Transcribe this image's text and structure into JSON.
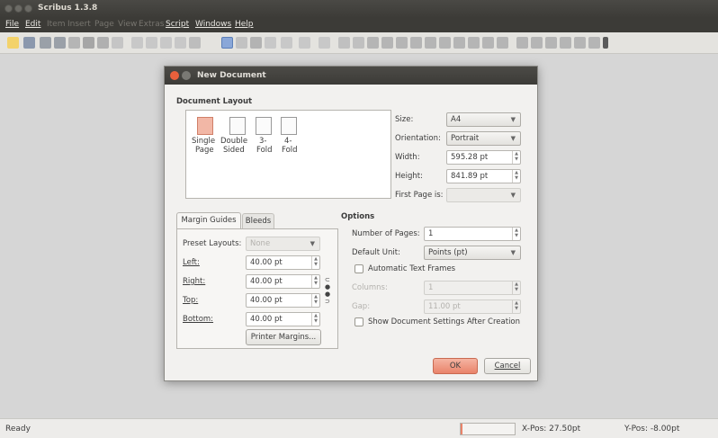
{
  "window": {
    "title": "Scribus 1.3.8"
  },
  "menu": [
    "File",
    "Edit",
    "Item",
    "Insert",
    "Page",
    "View",
    "Extras",
    "Script",
    "Windows",
    "Help"
  ],
  "menu_disabled": [
    false,
    false,
    true,
    true,
    true,
    true,
    true,
    false,
    false,
    false
  ],
  "dialog": {
    "title": "New Document",
    "layout_heading": "Document Layout",
    "layouts": [
      {
        "l1": "Single",
        "l2": "Page"
      },
      {
        "l1": "Double",
        "l2": "Sided"
      },
      {
        "l1": "3-",
        "l2": "Fold"
      },
      {
        "l1": "4-",
        "l2": "Fold"
      }
    ],
    "size_label": "Size:",
    "size_value": "A4",
    "orientation_label": "Orientation:",
    "orientation_value": "Portrait",
    "width_label": "Width:",
    "width_value": "595.28 pt",
    "height_label": "Height:",
    "height_value": "841.89 pt",
    "first_page_label": "First Page is:",
    "tabs": [
      "Margin Guides",
      "Bleeds"
    ],
    "preset_label": "Preset Layouts:",
    "preset_value": "None",
    "margins": [
      {
        "label": "Left:",
        "value": "40.00 pt"
      },
      {
        "label": "Right:",
        "value": "40.00 pt"
      },
      {
        "label": "Top:",
        "value": "40.00 pt"
      },
      {
        "label": "Bottom:",
        "value": "40.00 pt"
      }
    ],
    "printer_margins": "Printer Margins...",
    "options_heading": "Options",
    "num_pages_label": "Number of Pages:",
    "num_pages_value": "1",
    "unit_label": "Default Unit:",
    "unit_value": "Points (pt)",
    "auto_frames_label": "Automatic Text Frames",
    "columns_label": "Columns:",
    "columns_value": "1",
    "gap_label": "Gap:",
    "gap_value": "11.00 pt",
    "show_settings_label": "Show Document Settings After Creation",
    "ok_label": "OK",
    "cancel_label": "Cancel"
  },
  "status": {
    "text": "Ready",
    "xpos": "X-Pos: 27.50pt",
    "ypos": "Y-Pos: -8.00pt"
  },
  "colors": {
    "accent": "#e9836a",
    "titlebar": "#3c3b37",
    "ok_button": "#f0a48f"
  }
}
